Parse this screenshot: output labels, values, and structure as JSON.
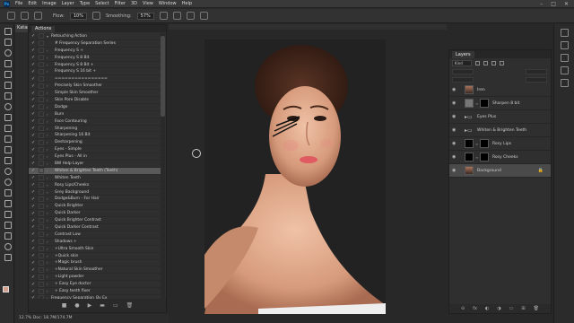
{
  "menu": [
    "File",
    "Edit",
    "Image",
    "Layer",
    "Type",
    "Select",
    "Filter",
    "3D",
    "View",
    "Window",
    "Help"
  ],
  "options": {
    "flow_label": "Flow:",
    "flow_value": "10%",
    "smoothing_label": "Smoothing:",
    "smoothing_value": "57%"
  },
  "doc_tab": "Katari",
  "actions": {
    "tab": "Actions",
    "rows": [
      {
        "name": "Retouching Action",
        "indent": false,
        "tw": "▾"
      },
      {
        "name": "# Frequency Separation Series",
        "indent": true,
        "tw": ""
      },
      {
        "name": "Frequency S +",
        "indent": true,
        "tw": "›"
      },
      {
        "name": "Frequency S 8 Bit",
        "indent": true,
        "tw": "›"
      },
      {
        "name": "Frequency S 8 Bit +",
        "indent": true,
        "tw": "›"
      },
      {
        "name": "Frequency S 16 bit +",
        "indent": true,
        "tw": "›"
      },
      {
        "name": "================",
        "indent": true,
        "tw": ""
      },
      {
        "name": "Precisely Skin Smoother",
        "indent": true,
        "tw": "›"
      },
      {
        "name": "Simple Skin Smoother",
        "indent": true,
        "tw": "›"
      },
      {
        "name": "Skin Pore Disable",
        "indent": true,
        "tw": "›"
      },
      {
        "name": "Dodge",
        "indent": true,
        "tw": "›"
      },
      {
        "name": "Burn",
        "indent": true,
        "tw": "›"
      },
      {
        "name": "Face Contouring",
        "indent": true,
        "tw": "›"
      },
      {
        "name": "Sharpening",
        "indent": true,
        "tw": "›"
      },
      {
        "name": "Sharpening 16 Bit",
        "indent": true,
        "tw": "›"
      },
      {
        "name": "Desharpening",
        "indent": true,
        "tw": "›"
      },
      {
        "name": "Eyes - Simple",
        "indent": true,
        "tw": "›"
      },
      {
        "name": "Eyes Plus - All in",
        "indent": true,
        "tw": "›"
      },
      {
        "name": "BW Help Layer",
        "indent": true,
        "tw": "›"
      },
      {
        "name": "Whiten & Brighten Teeth (Teeth)",
        "indent": true,
        "tw": "›",
        "sel": true
      },
      {
        "name": "Whiten Teeth",
        "indent": true,
        "tw": "›"
      },
      {
        "name": "Rosy Lips/Cheeks",
        "indent": true,
        "tw": "›"
      },
      {
        "name": "Grey Background",
        "indent": true,
        "tw": "›"
      },
      {
        "name": "Dodge&Burn - For Hair",
        "indent": true,
        "tw": "›"
      },
      {
        "name": "Quick Brighter",
        "indent": true,
        "tw": "›"
      },
      {
        "name": "Quick Darker",
        "indent": true,
        "tw": "›"
      },
      {
        "name": "Quick Brighter Contrast",
        "indent": true,
        "tw": "›"
      },
      {
        "name": "Quick Darker Contrast",
        "indent": true,
        "tw": "›"
      },
      {
        "name": "Contrast Low",
        "indent": true,
        "tw": "›"
      },
      {
        "name": "Shadows +",
        "indent": true,
        "tw": "›"
      },
      {
        "name": "+Ultra Smooth Skin",
        "indent": true,
        "tw": "›"
      },
      {
        "name": "+Quick skin",
        "indent": true,
        "tw": "›"
      },
      {
        "name": "+Magic brush",
        "indent": true,
        "tw": "›"
      },
      {
        "name": "+Natural Skin Smoother",
        "indent": true,
        "tw": "›"
      },
      {
        "name": "+Light powder",
        "indent": true,
        "tw": "›"
      },
      {
        "name": "+ Easy Eye doctor",
        "indent": true,
        "tw": "›"
      },
      {
        "name": "+ Easy teeth fixer",
        "indent": true,
        "tw": "›"
      },
      {
        "name": "Frequency Separation_By Ex",
        "indent": false,
        "tw": "›"
      }
    ],
    "footer": [
      "■",
      "●",
      "▶",
      "▬",
      "▭",
      "🗑"
    ]
  },
  "status": "12.7%   Doc: 18.7M/174.7M",
  "layers": {
    "tab": "Layers",
    "kind": "Kind",
    "rows": [
      {
        "name": "Iren",
        "thumb": "photo",
        "mask": false,
        "folder": false
      },
      {
        "name": "Sharpen 8 bit",
        "thumb": "grey",
        "mask": true,
        "folder": false
      },
      {
        "name": "Eyes Plus",
        "thumb": "",
        "mask": false,
        "folder": true
      },
      {
        "name": "Whiten & Brighten Teeth",
        "thumb": "",
        "mask": false,
        "folder": true
      },
      {
        "name": "Rosy Lips",
        "thumb": "black",
        "mask": true,
        "folder": false
      },
      {
        "name": "Rosy Cheeks",
        "thumb": "black",
        "mask": true,
        "folder": false
      },
      {
        "name": "Background",
        "thumb": "photo",
        "mask": false,
        "folder": false,
        "sel": true,
        "lock": true
      }
    ],
    "footer": [
      "⊝",
      "fx",
      "◐",
      "◑",
      "▭",
      "⊞",
      "🗑"
    ]
  }
}
